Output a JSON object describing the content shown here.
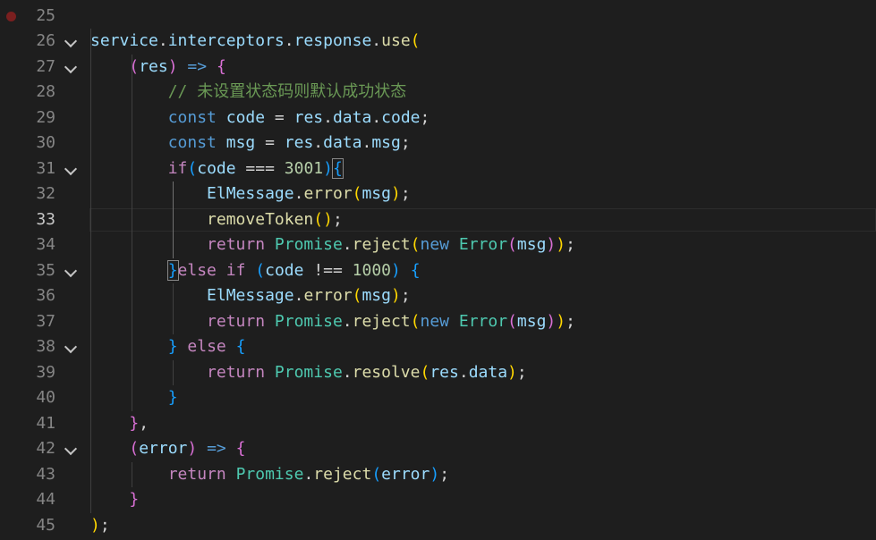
{
  "editor": {
    "current_line": 33,
    "breakpoint_line": 25,
    "lines": [
      {
        "n": "25",
        "tokens": []
      },
      {
        "n": "26",
        "tokens": [
          {
            "t": "service",
            "c": "var"
          },
          {
            "t": ".",
            "c": "txt"
          },
          {
            "t": "interceptors",
            "c": "var"
          },
          {
            "t": ".",
            "c": "txt"
          },
          {
            "t": "response",
            "c": "var"
          },
          {
            "t": ".",
            "c": "txt"
          },
          {
            "t": "use",
            "c": "fn"
          },
          {
            "t": "(",
            "c": "b1"
          }
        ]
      },
      {
        "n": "27",
        "tokens": [
          {
            "t": "    ",
            "c": "txt"
          },
          {
            "t": "(",
            "c": "b2"
          },
          {
            "t": "res",
            "c": "var"
          },
          {
            "t": ")",
            "c": "b2"
          },
          {
            "t": " ",
            "c": "txt"
          },
          {
            "t": "=>",
            "c": "kw"
          },
          {
            "t": " ",
            "c": "txt"
          },
          {
            "t": "{",
            "c": "b2"
          }
        ]
      },
      {
        "n": "28",
        "tokens": [
          {
            "t": "        ",
            "c": "txt"
          },
          {
            "t": "// 未设置状态码则默认成功状态",
            "c": "cm"
          }
        ]
      },
      {
        "n": "29",
        "tokens": [
          {
            "t": "        ",
            "c": "txt"
          },
          {
            "t": "const",
            "c": "kw"
          },
          {
            "t": " ",
            "c": "txt"
          },
          {
            "t": "code",
            "c": "var"
          },
          {
            "t": " = ",
            "c": "txt"
          },
          {
            "t": "res",
            "c": "var"
          },
          {
            "t": ".",
            "c": "txt"
          },
          {
            "t": "data",
            "c": "var"
          },
          {
            "t": ".",
            "c": "txt"
          },
          {
            "t": "code",
            "c": "var"
          },
          {
            "t": ";",
            "c": "txt"
          }
        ]
      },
      {
        "n": "30",
        "tokens": [
          {
            "t": "        ",
            "c": "txt"
          },
          {
            "t": "const",
            "c": "kw"
          },
          {
            "t": " ",
            "c": "txt"
          },
          {
            "t": "msg",
            "c": "var"
          },
          {
            "t": " = ",
            "c": "txt"
          },
          {
            "t": "res",
            "c": "var"
          },
          {
            "t": ".",
            "c": "txt"
          },
          {
            "t": "data",
            "c": "var"
          },
          {
            "t": ".",
            "c": "txt"
          },
          {
            "t": "msg",
            "c": "var"
          },
          {
            "t": ";",
            "c": "txt"
          }
        ]
      },
      {
        "n": "31",
        "tokens": [
          {
            "t": "        ",
            "c": "txt"
          },
          {
            "t": "if",
            "c": "ctl"
          },
          {
            "t": "(",
            "c": "b3"
          },
          {
            "t": "code",
            "c": "var"
          },
          {
            "t": " === ",
            "c": "txt"
          },
          {
            "t": "3001",
            "c": "num"
          },
          {
            "t": ")",
            "c": "b3"
          },
          {
            "t": "{",
            "c": "b3 bm"
          }
        ]
      },
      {
        "n": "32",
        "tokens": [
          {
            "t": "            ",
            "c": "txt"
          },
          {
            "t": "ElMessage",
            "c": "var"
          },
          {
            "t": ".",
            "c": "txt"
          },
          {
            "t": "error",
            "c": "fn"
          },
          {
            "t": "(",
            "c": "b1"
          },
          {
            "t": "msg",
            "c": "var"
          },
          {
            "t": ")",
            "c": "b1"
          },
          {
            "t": ";",
            "c": "txt"
          }
        ]
      },
      {
        "n": "33",
        "tokens": [
          {
            "t": "            ",
            "c": "txt"
          },
          {
            "t": "removeToken",
            "c": "fn"
          },
          {
            "t": "()",
            "c": "b1"
          },
          {
            "t": ";",
            "c": "txt"
          }
        ]
      },
      {
        "n": "34",
        "tokens": [
          {
            "t": "            ",
            "c": "txt"
          },
          {
            "t": "return",
            "c": "ctl"
          },
          {
            "t": " ",
            "c": "txt"
          },
          {
            "t": "Promise",
            "c": "cls"
          },
          {
            "t": ".",
            "c": "txt"
          },
          {
            "t": "reject",
            "c": "fn"
          },
          {
            "t": "(",
            "c": "b1"
          },
          {
            "t": "new",
            "c": "kw"
          },
          {
            "t": " ",
            "c": "txt"
          },
          {
            "t": "Error",
            "c": "cls"
          },
          {
            "t": "(",
            "c": "b2"
          },
          {
            "t": "msg",
            "c": "var"
          },
          {
            "t": ")",
            "c": "b2"
          },
          {
            "t": ")",
            "c": "b1"
          },
          {
            "t": ";",
            "c": "txt"
          }
        ]
      },
      {
        "n": "35",
        "tokens": [
          {
            "t": "        ",
            "c": "txt"
          },
          {
            "t": "}",
            "c": "b3 bm"
          },
          {
            "t": "else",
            "c": "ctl"
          },
          {
            "t": " ",
            "c": "txt"
          },
          {
            "t": "if",
            "c": "ctl"
          },
          {
            "t": " ",
            "c": "txt"
          },
          {
            "t": "(",
            "c": "b3"
          },
          {
            "t": "code",
            "c": "var"
          },
          {
            "t": " !== ",
            "c": "txt"
          },
          {
            "t": "1000",
            "c": "num"
          },
          {
            "t": ")",
            "c": "b3"
          },
          {
            "t": " ",
            "c": "txt"
          },
          {
            "t": "{",
            "c": "b3"
          }
        ]
      },
      {
        "n": "36",
        "tokens": [
          {
            "t": "            ",
            "c": "txt"
          },
          {
            "t": "ElMessage",
            "c": "var"
          },
          {
            "t": ".",
            "c": "txt"
          },
          {
            "t": "error",
            "c": "fn"
          },
          {
            "t": "(",
            "c": "b1"
          },
          {
            "t": "msg",
            "c": "var"
          },
          {
            "t": ")",
            "c": "b1"
          },
          {
            "t": ";",
            "c": "txt"
          }
        ]
      },
      {
        "n": "37",
        "tokens": [
          {
            "t": "            ",
            "c": "txt"
          },
          {
            "t": "return",
            "c": "ctl"
          },
          {
            "t": " ",
            "c": "txt"
          },
          {
            "t": "Promise",
            "c": "cls"
          },
          {
            "t": ".",
            "c": "txt"
          },
          {
            "t": "reject",
            "c": "fn"
          },
          {
            "t": "(",
            "c": "b1"
          },
          {
            "t": "new",
            "c": "kw"
          },
          {
            "t": " ",
            "c": "txt"
          },
          {
            "t": "Error",
            "c": "cls"
          },
          {
            "t": "(",
            "c": "b2"
          },
          {
            "t": "msg",
            "c": "var"
          },
          {
            "t": ")",
            "c": "b2"
          },
          {
            "t": ")",
            "c": "b1"
          },
          {
            "t": ";",
            "c": "txt"
          }
        ]
      },
      {
        "n": "38",
        "tokens": [
          {
            "t": "        ",
            "c": "txt"
          },
          {
            "t": "}",
            "c": "b3"
          },
          {
            "t": " ",
            "c": "txt"
          },
          {
            "t": "else",
            "c": "ctl"
          },
          {
            "t": " ",
            "c": "txt"
          },
          {
            "t": "{",
            "c": "b3"
          }
        ]
      },
      {
        "n": "39",
        "tokens": [
          {
            "t": "            ",
            "c": "txt"
          },
          {
            "t": "return",
            "c": "ctl"
          },
          {
            "t": " ",
            "c": "txt"
          },
          {
            "t": "Promise",
            "c": "cls"
          },
          {
            "t": ".",
            "c": "txt"
          },
          {
            "t": "resolve",
            "c": "fn"
          },
          {
            "t": "(",
            "c": "b1"
          },
          {
            "t": "res",
            "c": "var"
          },
          {
            "t": ".",
            "c": "txt"
          },
          {
            "t": "data",
            "c": "var"
          },
          {
            "t": ")",
            "c": "b1"
          },
          {
            "t": ";",
            "c": "txt"
          }
        ]
      },
      {
        "n": "40",
        "tokens": [
          {
            "t": "        ",
            "c": "txt"
          },
          {
            "t": "}",
            "c": "b3"
          }
        ]
      },
      {
        "n": "41",
        "tokens": [
          {
            "t": "    ",
            "c": "txt"
          },
          {
            "t": "}",
            "c": "b2"
          },
          {
            "t": ",",
            "c": "txt"
          }
        ]
      },
      {
        "n": "42",
        "tokens": [
          {
            "t": "    ",
            "c": "txt"
          },
          {
            "t": "(",
            "c": "b2"
          },
          {
            "t": "error",
            "c": "var"
          },
          {
            "t": ")",
            "c": "b2"
          },
          {
            "t": " ",
            "c": "txt"
          },
          {
            "t": "=>",
            "c": "kw"
          },
          {
            "t": " ",
            "c": "txt"
          },
          {
            "t": "{",
            "c": "b2"
          }
        ]
      },
      {
        "n": "43",
        "tokens": [
          {
            "t": "        ",
            "c": "txt"
          },
          {
            "t": "return",
            "c": "ctl"
          },
          {
            "t": " ",
            "c": "txt"
          },
          {
            "t": "Promise",
            "c": "cls"
          },
          {
            "t": ".",
            "c": "txt"
          },
          {
            "t": "reject",
            "c": "fn"
          },
          {
            "t": "(",
            "c": "b3"
          },
          {
            "t": "error",
            "c": "var"
          },
          {
            "t": ")",
            "c": "b3"
          },
          {
            "t": ";",
            "c": "txt"
          }
        ]
      },
      {
        "n": "44",
        "tokens": [
          {
            "t": "    ",
            "c": "txt"
          },
          {
            "t": "}",
            "c": "b2"
          }
        ]
      },
      {
        "n": "45",
        "tokens": [
          {
            "t": ")",
            "c": "b1"
          },
          {
            "t": ";",
            "c": "txt"
          }
        ]
      }
    ],
    "fold_lines": [
      "26",
      "27",
      "31",
      "35",
      "38",
      "42"
    ]
  }
}
